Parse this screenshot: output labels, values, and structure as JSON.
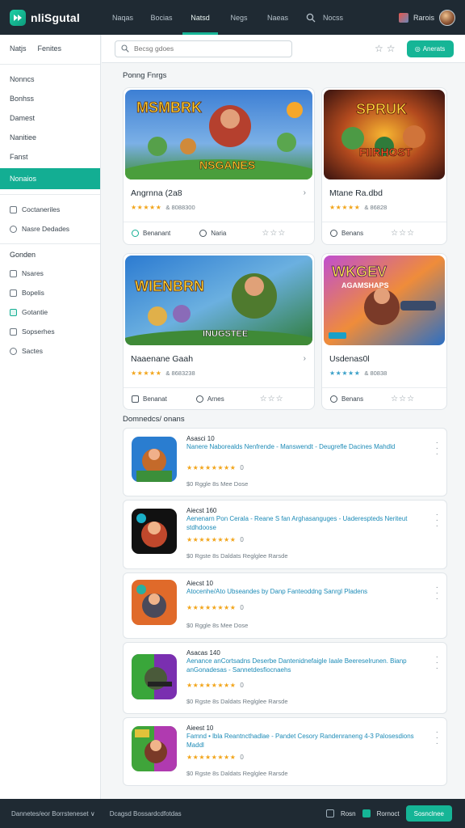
{
  "topbar": {
    "brand": "nliSgutal",
    "nav": [
      "Naqas",
      "Bocias",
      "Natsd",
      "Negs",
      "Naeas"
    ],
    "active_nav": 2,
    "news": "Nocss",
    "user_label": "Rarois"
  },
  "sidebar": {
    "top_links": [
      "Natjs",
      "Fenites"
    ],
    "links": [
      "Nonncs",
      "Bonhss",
      "Damest",
      "Nanitiee",
      "Fanst"
    ],
    "active": "Nonaios",
    "icon_items_a": [
      "Coctaneriles",
      "Nasre Dedades"
    ],
    "heading": "Gonden",
    "icon_items_b": [
      "Nsares",
      "Bopelis",
      "Gotantie",
      "Sopserhes",
      "Sactes"
    ]
  },
  "toolbar": {
    "search_placeholder": "Becsg gdoes",
    "button_label": "Anerats"
  },
  "sections": {
    "featured": "Ponng Fnrgs",
    "recommended": "Domnedcs/ onans"
  },
  "cards": [
    {
      "title": "Angrnna (2a8",
      "stars": "★★★★★",
      "rating": "& 8088300",
      "actions": [
        "Benanant",
        "Naria"
      ],
      "art_text": "MSMBRK",
      "art_sub": "NSGANES"
    },
    {
      "title": "Mtane Ra.dbd",
      "stars": "★★★★★",
      "rating": "& 86828",
      "actions": [
        "Benans",
        ""
      ],
      "art_text": "SPRUK",
      "art_sub": "FIIRHOST"
    },
    {
      "title": "Naaenane Gaah",
      "stars": "★★★★★",
      "rating": "& 8683238",
      "actions": [
        "Benanat",
        "Arnes"
      ],
      "art_text": "WIENBRN",
      "art_sub": "INUGSTEE"
    },
    {
      "title": "Usdenas0l",
      "stars": "★★★★★",
      "rating": "& 80838",
      "actions": [
        "Benans",
        ""
      ],
      "art_text": "WKGEV",
      "art_sub": "AGAMSHAPS"
    }
  ],
  "list": [
    {
      "name": "Asasci 10",
      "desc": "Nanere Naborealds Nenfrende - Manswendt - Deugrefle Dacines Mahdld",
      "rating_val": "0",
      "meta": "$0  Rggle  8s  Mee Dose"
    },
    {
      "name": "Aiecst 160",
      "desc": "Aenenarn  Pon Cerala  - Reane S fan Arghasanguges  - Uaderespteds Neriteut stdhdoose",
      "rating_val": "0",
      "meta": "$0  Rgste  8s  Daldats  Reglglee  Rarsde"
    },
    {
      "name": "Aiecst 10",
      "desc": "Atocenhe/Ato Ubseandes  by  Danp Fanteoddng  Sanrgl  Pladens",
      "rating_val": "0",
      "meta": "$0  Rggle  8s  Mee Dose"
    },
    {
      "name": "Asacas 140",
      "desc": "Aenance anCortsadns Deserbe Dantenidnefaigle  Iaale  Beereselrunen. Bianp anGonadesas  - Sannetdesfiocnaehs",
      "rating_val": "0",
      "meta": "$0  Rgste  8s  Daldats  Reglglee  Rarsde"
    },
    {
      "name": "Aieest 10",
      "desc": "Famnd • lbla Reantncthadlae  - Pandet Cesory  Randenraneng 4-3 Palosesdions  Maddl",
      "rating_val": "0",
      "meta": "$0  Rgste  8s  Daldats  Reglglee  Rarsde"
    }
  ],
  "footer": {
    "left": "Dannetes/eor Borrsteneset",
    "mid": "Dcagsd Bossardcdfotdas",
    "right_label_1": "Rosn",
    "right_label_2": "Rornoct",
    "button": "Sosnclnee"
  }
}
